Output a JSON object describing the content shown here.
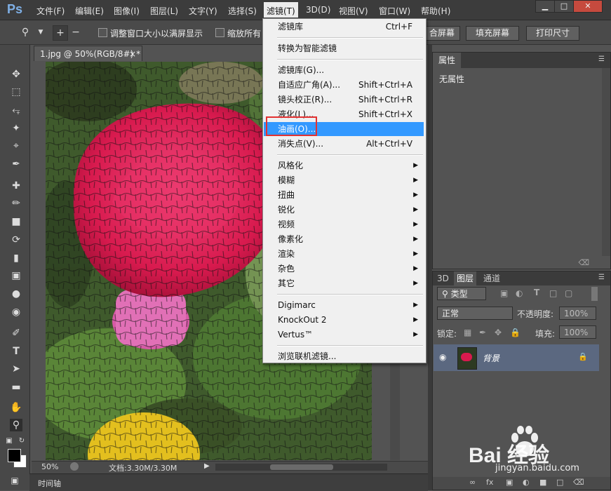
{
  "app": {
    "logo": "Ps"
  },
  "menubar": {
    "items": [
      "文件(F)",
      "编辑(E)",
      "图像(I)",
      "图层(L)",
      "文字(Y)",
      "选择(S)",
      "滤镜(T)",
      "3D(D)",
      "视图(V)",
      "窗口(W)",
      "帮助(H)"
    ],
    "active_item": "滤镜(T)"
  },
  "window_controls": {
    "minimize": "▁",
    "restore": "□",
    "close": "✕"
  },
  "options_bar": {
    "tool_icon": "zoom-icon",
    "checkbox1_label": "调整窗口大小以满屏显示",
    "checkbox2_label": "缩放所有",
    "btn_fit_partial": "合屏幕",
    "btn_fill": "填充屏幕",
    "btn_print": "打印尺寸"
  },
  "document": {
    "tab_title": "1.jpg @ 50%(RGB/8#) *",
    "tab_close": "×",
    "zoom": "50%",
    "doc_size": "文档:3.30M/3.30M"
  },
  "timeline": {
    "label": "时间轴"
  },
  "properties_panel": {
    "tab": "属性",
    "content": "无属性"
  },
  "layers_panel": {
    "tabs": [
      "3D",
      "图层",
      "通道"
    ],
    "active_tab": "图层",
    "filter_kind": "类型",
    "blend_mode": "正常",
    "opacity_label": "不透明度:",
    "opacity_value": "100%",
    "lock_label": "锁定:",
    "fill_label": "填充:",
    "fill_value": "100%",
    "layers": [
      {
        "name": "背景",
        "locked": true
      }
    ]
  },
  "filter_menu": {
    "groups": [
      [
        {
          "label": "滤镜库",
          "shortcut": "Ctrl+F"
        }
      ],
      [
        {
          "label": "转换为智能滤镜"
        }
      ],
      [
        {
          "label": "滤镜库(G)..."
        },
        {
          "label": "自适应广角(A)...",
          "shortcut": "Shift+Ctrl+A"
        },
        {
          "label": "镜头校正(R)...",
          "shortcut": "Shift+Ctrl+R"
        },
        {
          "label": "液化(L)...",
          "shortcut": "Shift+Ctrl+X"
        },
        {
          "label": "油画(O)...",
          "highlighted": true
        },
        {
          "label": "消失点(V)...",
          "shortcut": "Alt+Ctrl+V"
        }
      ],
      [
        {
          "label": "风格化",
          "submenu": true
        },
        {
          "label": "模糊",
          "submenu": true
        },
        {
          "label": "扭曲",
          "submenu": true
        },
        {
          "label": "锐化",
          "submenu": true
        },
        {
          "label": "视频",
          "submenu": true
        },
        {
          "label": "像素化",
          "submenu": true
        },
        {
          "label": "渲染",
          "submenu": true
        },
        {
          "label": "杂色",
          "submenu": true
        },
        {
          "label": "其它",
          "submenu": true
        }
      ],
      [
        {
          "label": "Digimarc",
          "submenu": true
        },
        {
          "label": "KnockOut 2",
          "submenu": true
        },
        {
          "label": "Vertus™",
          "submenu": true
        }
      ],
      [
        {
          "label": "浏览联机滤镜..."
        }
      ]
    ]
  },
  "watermark": {
    "text": "Bai 经验",
    "url": "jingyan.baidu.com"
  },
  "colors": {
    "menu_highlight": "#3399ff",
    "annotation_box": "#e23131",
    "selected_layer": "#5b6880"
  }
}
